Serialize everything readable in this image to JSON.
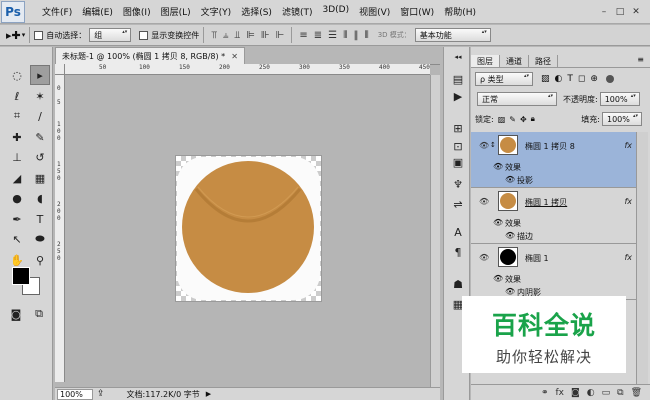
{
  "app": {
    "logo": "Ps"
  },
  "menu": [
    "文件(F)",
    "编辑(E)",
    "图像(I)",
    "图层(L)",
    "文字(Y)",
    "选择(S)",
    "滤镜(T)",
    "3D(D)",
    "视图(V)",
    "窗口(W)",
    "帮助(H)"
  ],
  "window_buttons": [
    "–",
    "□",
    "✕"
  ],
  "options": {
    "auto_select_label": "自动选择：",
    "auto_select_value": "组",
    "show_transform_label": "显示变换控件",
    "mode_3d": "3D 模式：",
    "workspace": "基本功能"
  },
  "document": {
    "tab_title": "未标题-1 @ 100% (椭圆 1 拷贝 8, RGB/8) *",
    "zoom": "100%",
    "doc_info": "文档:117.2K/0 字节",
    "ruler_top": [
      "50",
      "100",
      "150",
      "200",
      "250",
      "300",
      "350",
      "400",
      "450"
    ],
    "ruler_left": [
      "0",
      "5",
      "1",
      "0",
      "0",
      "1",
      "5",
      "0",
      "2",
      "0",
      "0",
      "2",
      "5",
      "0"
    ],
    "circle_color": "#c68c44"
  },
  "layers_panel": {
    "tabs": [
      "图层",
      "通道",
      "路径"
    ],
    "filter_type": "ρ 类型",
    "blend_mode": "正常",
    "opacity_label": "不透明度:",
    "opacity_value": "100%",
    "lock_label": "锁定:",
    "fill_label": "填充:",
    "fill_value": "100%",
    "layers": [
      {
        "name": "椭圆 1 拷贝 8",
        "effects_label": "效果",
        "effect": "投影",
        "selected": true
      },
      {
        "name": "椭圆 1 拷贝",
        "effects_label": "效果",
        "effect": "描边",
        "selected": false
      },
      {
        "name": "椭圆 1",
        "effects_label": "效果",
        "effect": "内阴影",
        "selected": false
      }
    ],
    "fx": "fx"
  },
  "watermark": {
    "title": "百科全说",
    "subtitle": "助你轻松解决"
  },
  "colors": {
    "accent_selection": "#9bb4d9",
    "watermark_green": "#1aa34a"
  }
}
